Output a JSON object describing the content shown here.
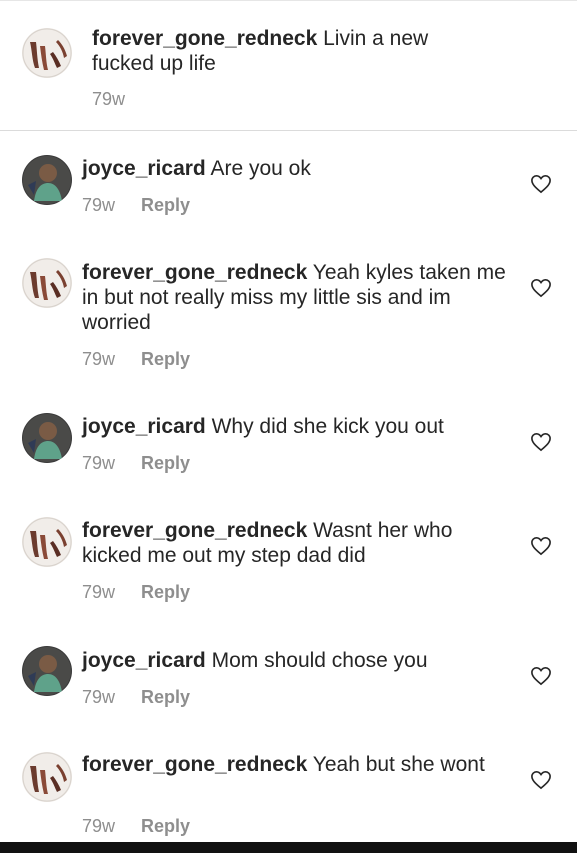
{
  "caption": {
    "username": "forever_gone_redneck",
    "text": "Livin a new fucked up life",
    "time": "79w"
  },
  "comments": [
    {
      "username": "joyce_ricard",
      "text": "Are you ok",
      "time": "79w",
      "reply_label": "Reply"
    },
    {
      "username": "forever_gone_redneck",
      "text": "Yeah kyles taken me in but not really miss my little sis and im worried",
      "time": "79w",
      "reply_label": "Reply"
    },
    {
      "username": "joyce_ricard",
      "text": "Why did she kick you out",
      "time": "79w",
      "reply_label": "Reply"
    },
    {
      "username": "forever_gone_redneck",
      "text": "Wasnt her who kicked me out my step dad did",
      "time": "79w",
      "reply_label": "Reply"
    },
    {
      "username": "joyce_ricard",
      "text": "Mom should chose you",
      "time": "79w",
      "reply_label": "Reply"
    },
    {
      "username": "forever_gone_redneck",
      "text": "Yeah but she wont",
      "time": "79w",
      "reply_label": "Reply"
    }
  ],
  "icons": {
    "like": "heart-outline-icon"
  },
  "colors": {
    "text": "#262626",
    "secondary": "#8e8e8e",
    "divider": "#dbdbdb"
  }
}
